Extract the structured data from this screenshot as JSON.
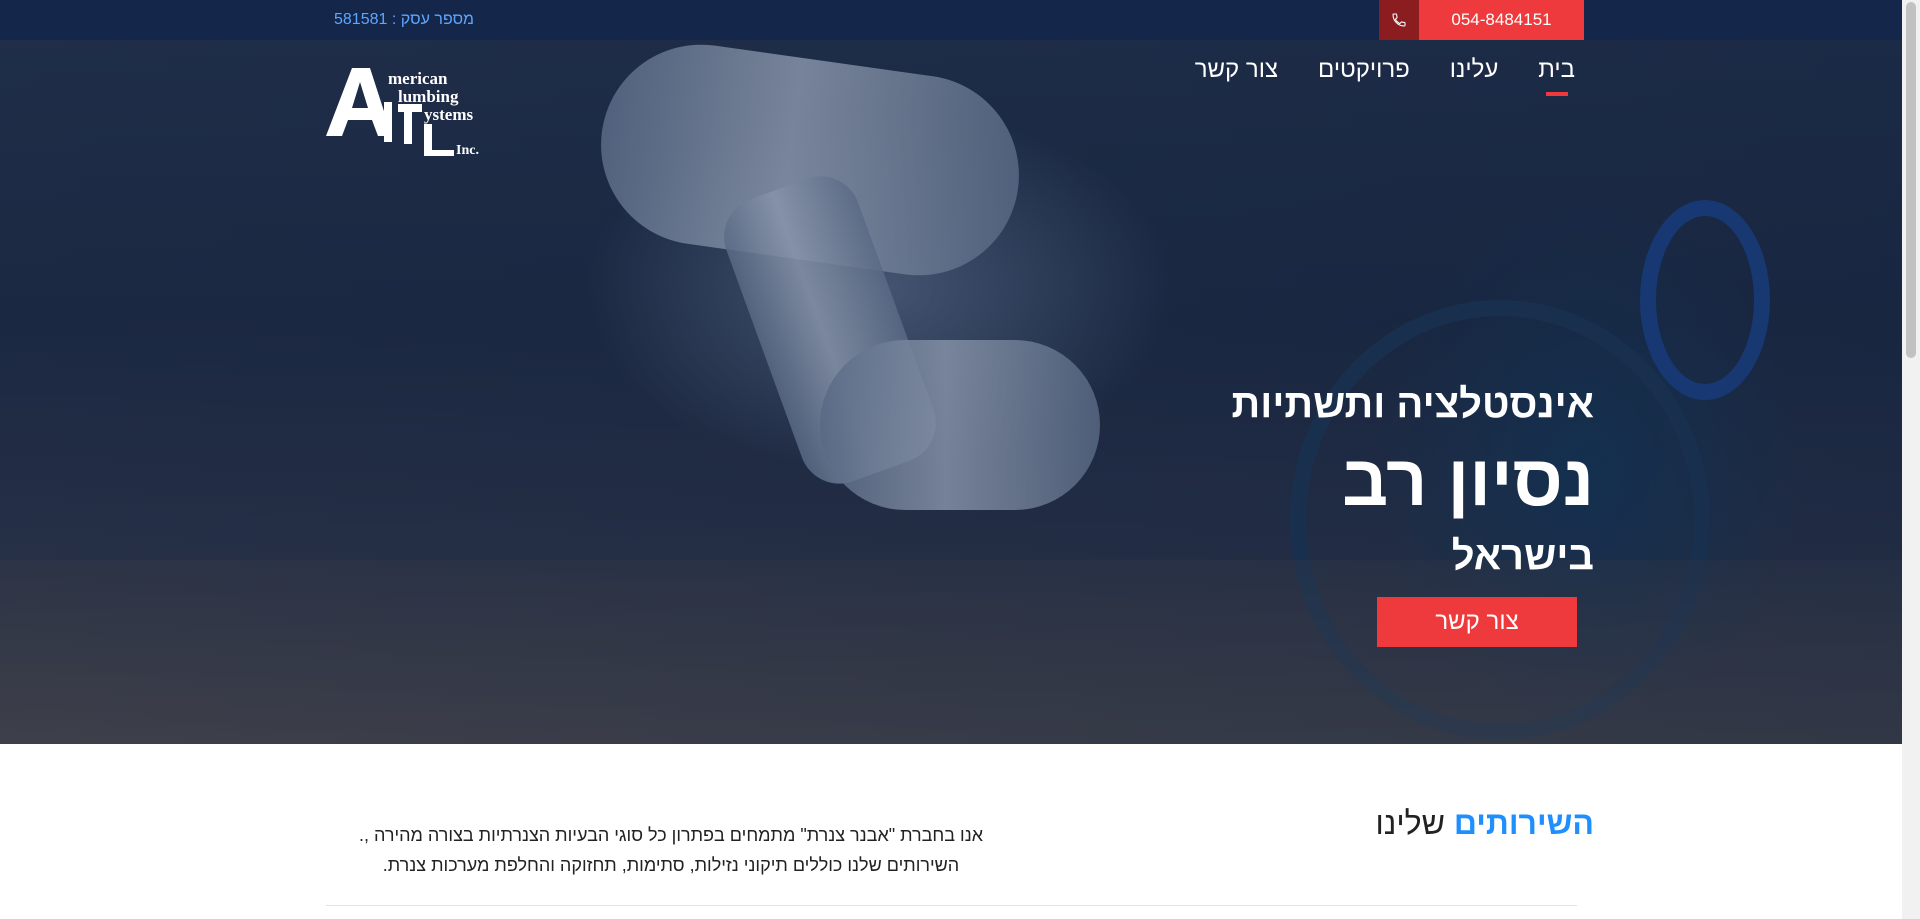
{
  "topbar": {
    "business_number": "מספר עסק : 581581",
    "phone": "054-8484151",
    "phone_icon": "phone-icon"
  },
  "nav": {
    "items": [
      {
        "label": "בית",
        "active": true
      },
      {
        "label": "עלינו",
        "active": false
      },
      {
        "label": "פרויקטים",
        "active": false
      },
      {
        "label": "צור קשר",
        "active": false
      }
    ]
  },
  "logo": {
    "line1": "merican",
    "line2": "lumbing",
    "line3": "ystems",
    "line4": "Inc."
  },
  "hero": {
    "subtitle": "אינסטלציה ותשתיות",
    "title": "נסיון רב",
    "location": "בישראל",
    "cta_label": "צור קשר"
  },
  "services": {
    "title_highlight": "השירותים",
    "title_rest": " שלינו",
    "description_line1": "אנו בחברת \"אבנר צנרת\" מתמחים בפתרון כל סוגי הבעיות הצנרתיות בצורה מהירה ,.",
    "description_line2": "השירותים שלנו כוללים תיקוני נזילות, סתימות, תחזוקה והחלפת מערכות צנרת."
  },
  "colors": {
    "topbar_bg": "#14264a",
    "accent_red": "#ee3a3c",
    "accent_blue": "#1f8fff"
  }
}
